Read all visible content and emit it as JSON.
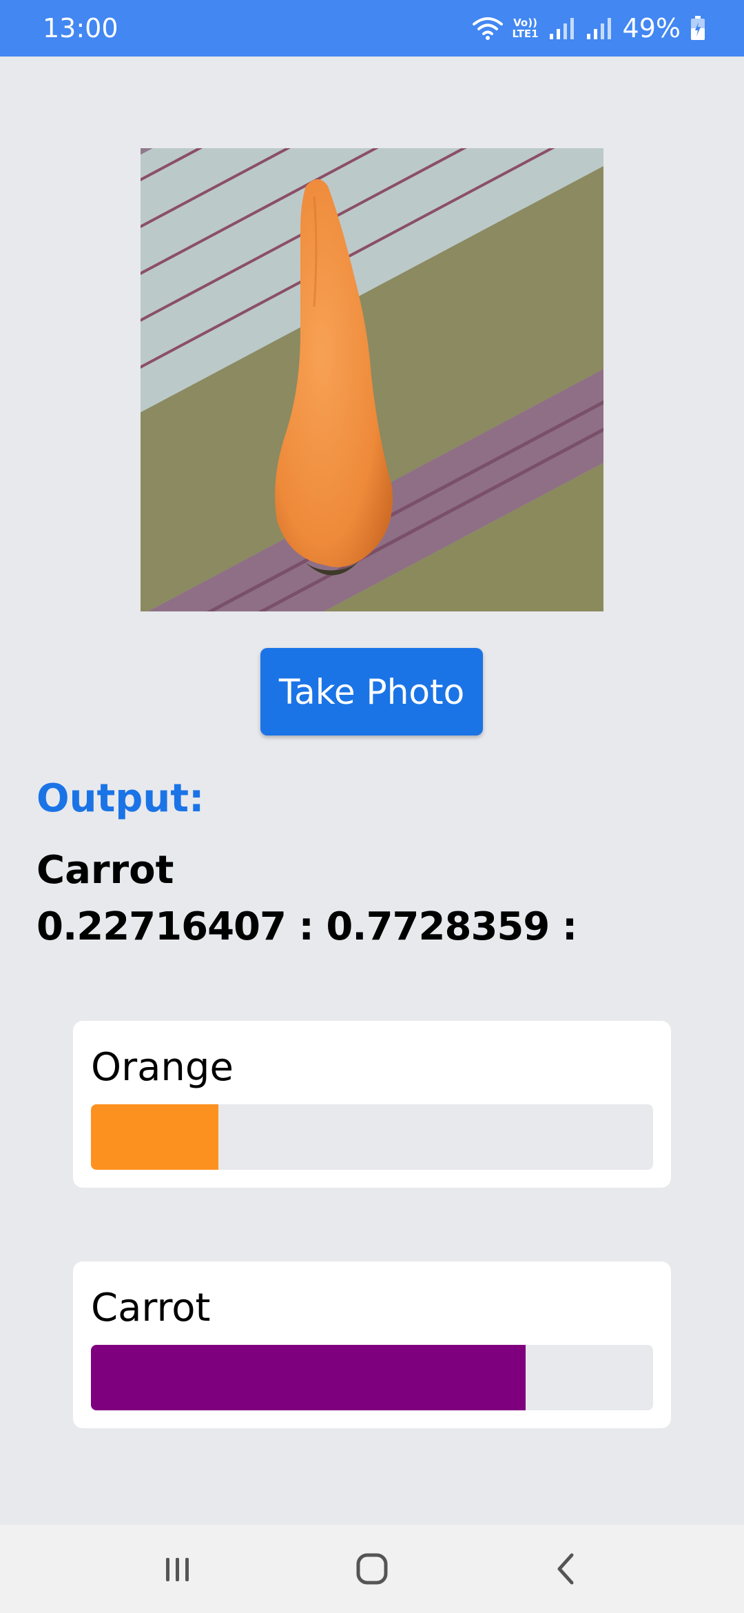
{
  "status_bar": {
    "time": "13:00",
    "network_label_top": "Vo))",
    "network_label_bottom": "LTE1",
    "battery": "49%"
  },
  "main": {
    "take_photo_label": "Take Photo",
    "output_heading": "Output:",
    "output_class": "Carrot",
    "output_scores": "0.22716407 : 0.7728359 :",
    "results": [
      {
        "label": "Orange",
        "score": 0.22716407,
        "color": "#fd911f"
      },
      {
        "label": "Carrot",
        "score": 0.7728359,
        "color": "#7f007f"
      }
    ]
  },
  "colors": {
    "status_bar": "#4287f2",
    "accent": "#1b74e6",
    "background": "#e8e9ed"
  },
  "nav_bar": {
    "icons": [
      "recents-icon",
      "home-icon",
      "back-icon"
    ]
  }
}
